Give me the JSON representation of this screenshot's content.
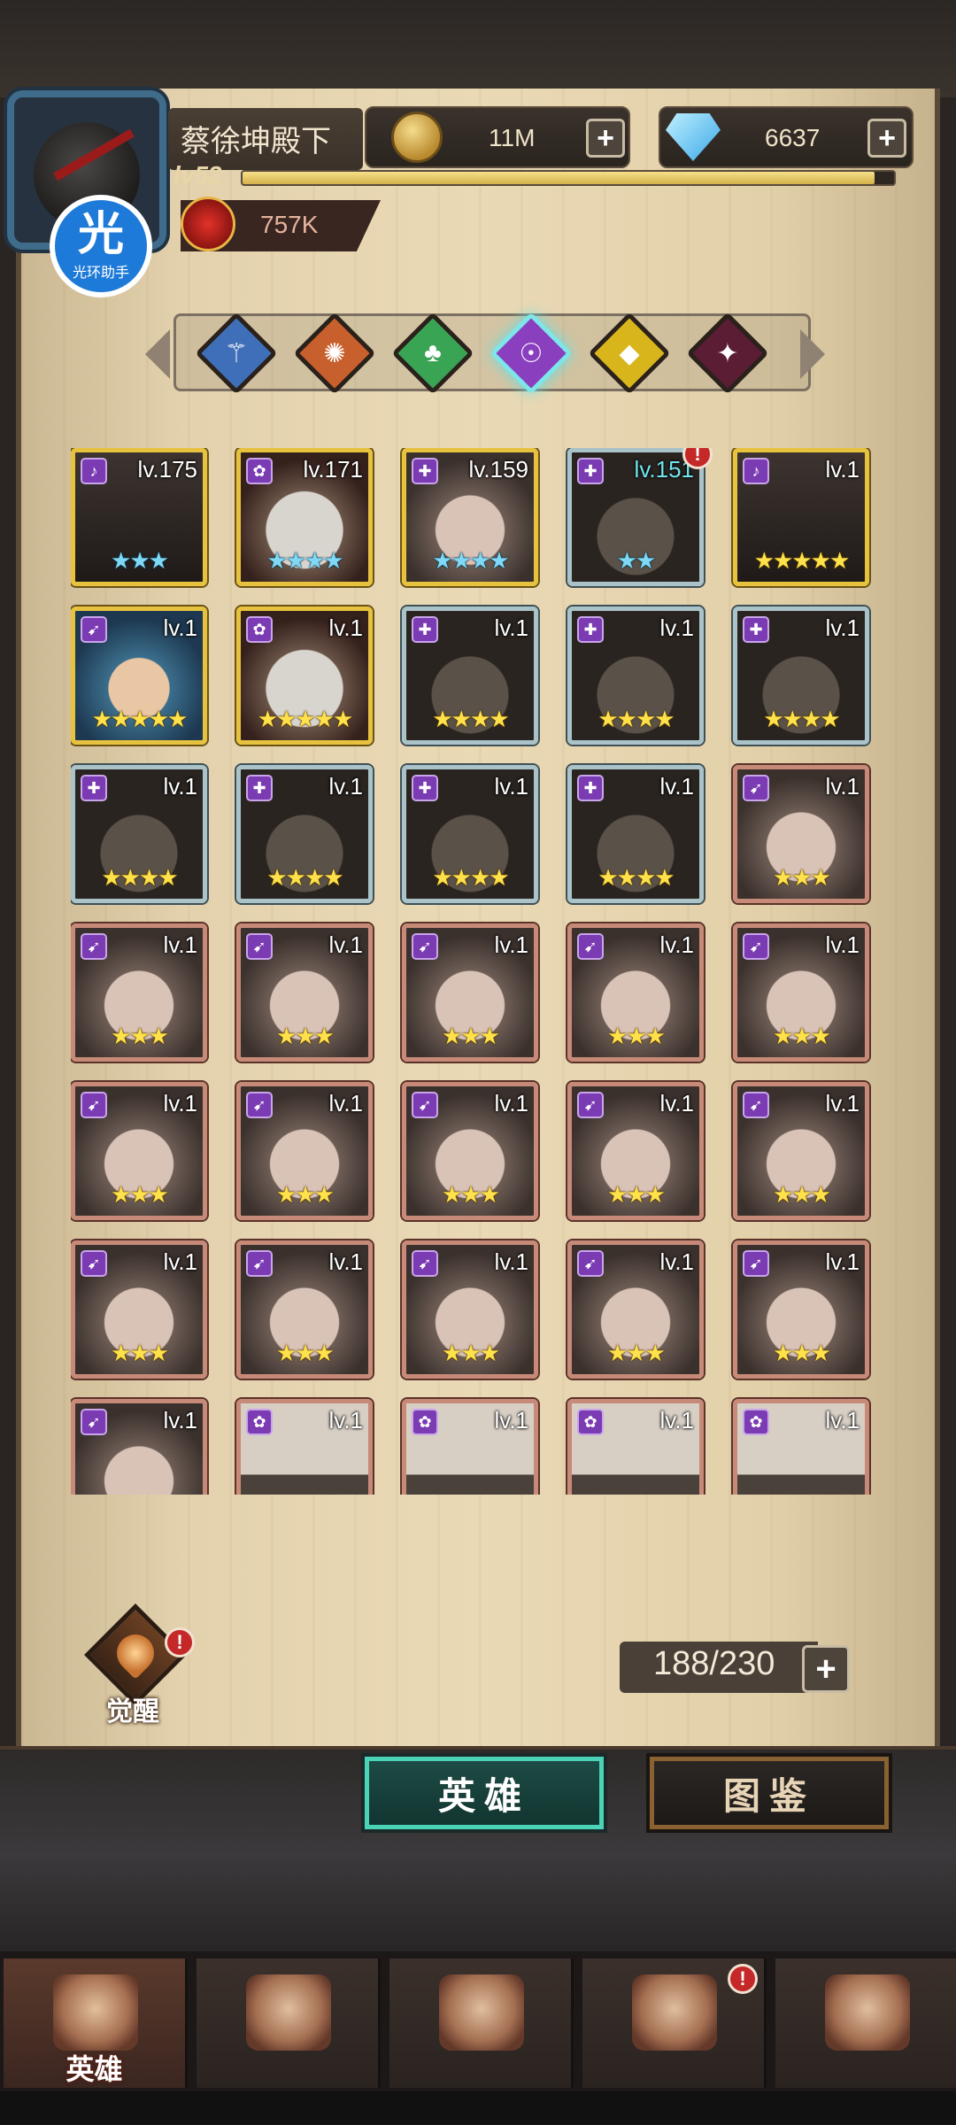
{
  "player": {
    "name": "蔡徐坤殿下",
    "level": "lv52",
    "xp_fraction": 0.97,
    "power": "757K"
  },
  "badge": {
    "main": "光",
    "sub": "光环助手"
  },
  "resources": {
    "gold": "11M",
    "diamonds": "6637",
    "plus": "+"
  },
  "element_filters": [
    {
      "name": "light-blue",
      "symbol": "⚚",
      "color": "#3f6fb8"
    },
    {
      "name": "fire",
      "symbol": "✺",
      "color": "#c8602e"
    },
    {
      "name": "nature",
      "symbol": "♣",
      "color": "#3aa455"
    },
    {
      "name": "arcane",
      "symbol": "☉",
      "color": "#8a3fbf"
    },
    {
      "name": "holy",
      "symbol": "◆",
      "color": "#d9b51c"
    },
    {
      "name": "dark",
      "symbol": "✦",
      "color": "#5a1d34"
    }
  ],
  "active_filter": 3,
  "heroes": [
    {
      "lv": "lv.175",
      "stars": "★★★",
      "star_color": "blue",
      "frame": "gold",
      "portrait": "p-dark",
      "cls": "♪"
    },
    {
      "lv": "lv.171",
      "stars": "★★★★",
      "star_color": "blue",
      "frame": "gold",
      "portrait": "p-white",
      "cls": "✿"
    },
    {
      "lv": "lv.159",
      "stars": "★★★★",
      "star_color": "blue",
      "frame": "gold",
      "portrait": "p-girl",
      "cls": "✚"
    },
    {
      "lv": "lv.151",
      "stars": "★★",
      "star_color": "blue",
      "frame": "silver",
      "portrait": "p-hood",
      "cls": "✚",
      "lv_cyan": true,
      "alert": "!"
    },
    {
      "lv": "lv.1",
      "stars": "★★★★★",
      "star_color": "gold",
      "frame": "gold",
      "portrait": "p-dark",
      "cls": "♪"
    },
    {
      "lv": "lv.1",
      "stars": "★★★★★",
      "star_color": "gold",
      "frame": "gold",
      "portrait": "p-blue",
      "cls": "➹"
    },
    {
      "lv": "lv.1",
      "stars": "★★★★★",
      "star_color": "gold",
      "frame": "gold",
      "portrait": "p-white",
      "cls": "✿"
    },
    {
      "lv": "lv.1",
      "stars": "★★★★",
      "star_color": "gold",
      "frame": "silver",
      "portrait": "p-hood",
      "cls": "✚"
    },
    {
      "lv": "lv.1",
      "stars": "★★★★",
      "star_color": "gold",
      "frame": "silver",
      "portrait": "p-hood",
      "cls": "✚"
    },
    {
      "lv": "lv.1",
      "stars": "★★★★",
      "star_color": "gold",
      "frame": "silver",
      "portrait": "p-hood",
      "cls": "✚"
    },
    {
      "lv": "lv.1",
      "stars": "★★★★",
      "star_color": "gold",
      "frame": "silver",
      "portrait": "p-hood",
      "cls": "✚"
    },
    {
      "lv": "lv.1",
      "stars": "★★★★",
      "star_color": "gold",
      "frame": "silver",
      "portrait": "p-hood",
      "cls": "✚"
    },
    {
      "lv": "lv.1",
      "stars": "★★★★",
      "star_color": "gold",
      "frame": "silver",
      "portrait": "p-hood",
      "cls": "✚"
    },
    {
      "lv": "lv.1",
      "stars": "★★★★",
      "star_color": "gold",
      "frame": "silver",
      "portrait": "p-hood",
      "cls": "✚"
    },
    {
      "lv": "lv.1",
      "stars": "★★★",
      "star_color": "gold",
      "frame": "bronze",
      "portrait": "p-girl",
      "cls": "➹"
    },
    {
      "lv": "lv.1",
      "stars": "★★★",
      "star_color": "gold",
      "frame": "bronze",
      "portrait": "p-girl",
      "cls": "➹"
    },
    {
      "lv": "lv.1",
      "stars": "★★★",
      "star_color": "gold",
      "frame": "bronze",
      "portrait": "p-girl",
      "cls": "➹"
    },
    {
      "lv": "lv.1",
      "stars": "★★★",
      "star_color": "gold",
      "frame": "bronze",
      "portrait": "p-girl",
      "cls": "➹"
    },
    {
      "lv": "lv.1",
      "stars": "★★★",
      "star_color": "gold",
      "frame": "bronze",
      "portrait": "p-girl",
      "cls": "➹"
    },
    {
      "lv": "lv.1",
      "stars": "★★★",
      "star_color": "gold",
      "frame": "bronze",
      "portrait": "p-girl",
      "cls": "➹"
    },
    {
      "lv": "lv.1",
      "stars": "★★★",
      "star_color": "gold",
      "frame": "bronze",
      "portrait": "p-girl",
      "cls": "➹"
    },
    {
      "lv": "lv.1",
      "stars": "★★★",
      "star_color": "gold",
      "frame": "bronze",
      "portrait": "p-girl",
      "cls": "➹"
    },
    {
      "lv": "lv.1",
      "stars": "★★★",
      "star_color": "gold",
      "frame": "bronze",
      "portrait": "p-girl",
      "cls": "➹"
    },
    {
      "lv": "lv.1",
      "stars": "★★★",
      "star_color": "gold",
      "frame": "bronze",
      "portrait": "p-girl",
      "cls": "➹"
    },
    {
      "lv": "lv.1",
      "stars": "★★★",
      "star_color": "gold",
      "frame": "bronze",
      "portrait": "p-girl",
      "cls": "➹"
    },
    {
      "lv": "lv.1",
      "stars": "★★★",
      "star_color": "gold",
      "frame": "bronze",
      "portrait": "p-girl",
      "cls": "➹"
    },
    {
      "lv": "lv.1",
      "stars": "★★★",
      "star_color": "gold",
      "frame": "bronze",
      "portrait": "p-girl",
      "cls": "➹"
    },
    {
      "lv": "lv.1",
      "stars": "★★★",
      "star_color": "gold",
      "frame": "bronze",
      "portrait": "p-girl",
      "cls": "➹"
    },
    {
      "lv": "lv.1",
      "stars": "★★★",
      "star_color": "gold",
      "frame": "bronze",
      "portrait": "p-girl",
      "cls": "➹"
    },
    {
      "lv": "lv.1",
      "stars": "★★★",
      "star_color": "gold",
      "frame": "bronze",
      "portrait": "p-girl",
      "cls": "➹"
    },
    {
      "lv": "lv.1",
      "stars": "",
      "star_color": "gold",
      "frame": "bronze",
      "portrait": "p-girl",
      "cls": "➹"
    },
    {
      "lv": "lv.1",
      "stars": "",
      "star_color": "gold",
      "frame": "bronze",
      "portrait": "p-bandage",
      "cls": "✿"
    },
    {
      "lv": "lv.1",
      "stars": "",
      "star_color": "gold",
      "frame": "bronze",
      "portrait": "p-bandage",
      "cls": "✿"
    },
    {
      "lv": "lv.1",
      "stars": "",
      "star_color": "gold",
      "frame": "bronze",
      "portrait": "p-bandage",
      "cls": "✿"
    },
    {
      "lv": "lv.1",
      "stars": "",
      "star_color": "gold",
      "frame": "bronze",
      "portrait": "p-bandage",
      "cls": "✿"
    }
  ],
  "awaken": {
    "label": "觉醒",
    "alert": "!"
  },
  "hero_count": "188/230",
  "segments": {
    "heroes": "英雄",
    "atlas": "图鉴"
  },
  "nav": [
    {
      "label": "英雄",
      "active": true
    },
    {
      "label": "",
      "active": false
    },
    {
      "label": "",
      "active": false
    },
    {
      "label": "",
      "active": false,
      "alert": "!"
    },
    {
      "label": "",
      "active": false
    }
  ]
}
